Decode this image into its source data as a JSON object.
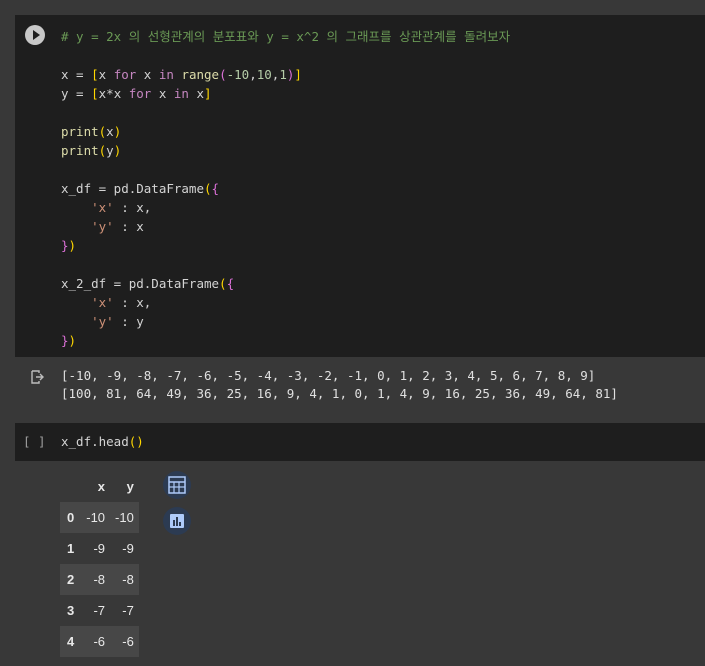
{
  "cell1": {
    "lines": [
      {
        "parts": [
          {
            "t": "# y = 2x 의 선형관계의 분포표와 y = x^2 의 그래프를 상관관계를 돌려보자",
            "c": "cm"
          }
        ]
      },
      {
        "parts": []
      },
      {
        "parts": [
          {
            "t": "x = "
          },
          {
            "t": "[",
            "c": "br"
          },
          {
            "t": "x "
          },
          {
            "t": "for",
            "c": "kw"
          },
          {
            "t": " x "
          },
          {
            "t": "in",
            "c": "kw"
          },
          {
            "t": " "
          },
          {
            "t": "range",
            "c": "fn"
          },
          {
            "t": "(",
            "c": "br2"
          },
          {
            "t": "-10",
            "c": "nm"
          },
          {
            "t": ","
          },
          {
            "t": "10",
            "c": "nm"
          },
          {
            "t": ","
          },
          {
            "t": "1",
            "c": "nm"
          },
          {
            "t": ")",
            "c": "br2"
          },
          {
            "t": "]",
            "c": "br"
          }
        ]
      },
      {
        "parts": [
          {
            "t": "y = "
          },
          {
            "t": "[",
            "c": "br"
          },
          {
            "t": "x*x "
          },
          {
            "t": "for",
            "c": "kw"
          },
          {
            "t": " x "
          },
          {
            "t": "in",
            "c": "kw"
          },
          {
            "t": " x"
          },
          {
            "t": "]",
            "c": "br"
          }
        ]
      },
      {
        "parts": []
      },
      {
        "parts": [
          {
            "t": "print",
            "c": "fn"
          },
          {
            "t": "(",
            "c": "br"
          },
          {
            "t": "x"
          },
          {
            "t": ")",
            "c": "br"
          }
        ]
      },
      {
        "parts": [
          {
            "t": "print",
            "c": "fn"
          },
          {
            "t": "(",
            "c": "br"
          },
          {
            "t": "y"
          },
          {
            "t": ")",
            "c": "br"
          }
        ]
      },
      {
        "parts": []
      },
      {
        "parts": [
          {
            "t": "x_df = pd.DataFrame"
          },
          {
            "t": "(",
            "c": "br"
          },
          {
            "t": "{",
            "c": "br2"
          }
        ]
      },
      {
        "parts": [
          {
            "t": "    "
          },
          {
            "t": "'x'",
            "c": "st"
          },
          {
            "t": " : x,"
          }
        ]
      },
      {
        "parts": [
          {
            "t": "    "
          },
          {
            "t": "'y'",
            "c": "st"
          },
          {
            "t": " : x"
          }
        ]
      },
      {
        "parts": [
          {
            "t": "}",
            "c": "br2"
          },
          {
            "t": ")",
            "c": "br"
          }
        ]
      },
      {
        "parts": []
      },
      {
        "parts": [
          {
            "t": "x_2_df = pd.DataFrame"
          },
          {
            "t": "(",
            "c": "br"
          },
          {
            "t": "{",
            "c": "br2"
          }
        ]
      },
      {
        "parts": [
          {
            "t": "    "
          },
          {
            "t": "'x'",
            "c": "st"
          },
          {
            "t": " : x,"
          }
        ]
      },
      {
        "parts": [
          {
            "t": "    "
          },
          {
            "t": "'y'",
            "c": "st"
          },
          {
            "t": " : y"
          }
        ]
      },
      {
        "parts": [
          {
            "t": "}",
            "c": "br2"
          },
          {
            "t": ")",
            "c": "br"
          }
        ]
      }
    ]
  },
  "output": {
    "line1": "[-10, -9, -8, -7, -6, -5, -4, -3, -2, -1, 0, 1, 2, 3, 4, 5, 6, 7, 8, 9]",
    "line2": "[100, 81, 64, 49, 36, 25, 16, 9, 4, 1, 0, 1, 4, 9, 16, 25, 36, 49, 64, 81]"
  },
  "cell2": {
    "bracket": "[ ]",
    "code_prefix": "x_df.head",
    "code_paren_open": "(",
    "code_paren_close": ")"
  },
  "dataframe": {
    "columns": [
      "x",
      "y"
    ],
    "rows": [
      {
        "index": "0",
        "x": "-10",
        "y": "-10"
      },
      {
        "index": "1",
        "x": "-9",
        "y": "-9"
      },
      {
        "index": "2",
        "x": "-8",
        "y": "-8"
      },
      {
        "index": "3",
        "x": "-7",
        "y": "-7"
      },
      {
        "index": "4",
        "x": "-6",
        "y": "-6"
      }
    ]
  },
  "icons": {
    "run": "play-icon",
    "output": "output-redirect-icon",
    "table": "table-icon",
    "chart": "bar-chart-icon"
  },
  "colors": {
    "comment": "#6a9955",
    "keyword": "#c586c0",
    "function": "#dcdcaa",
    "string": "#ce9178",
    "number": "#b5cea8"
  }
}
